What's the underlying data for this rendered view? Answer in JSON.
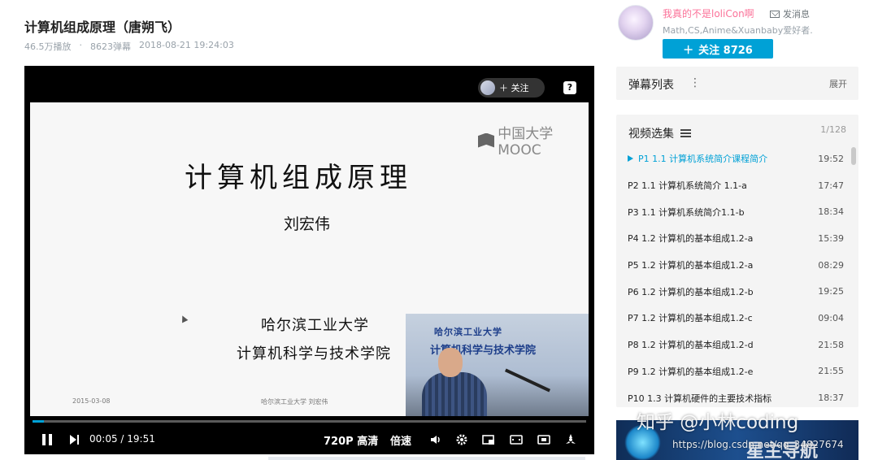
{
  "video": {
    "title": "计算机组成原理（唐朔飞）",
    "views": "46.5万播放",
    "danmaku_count": "8623弹幕",
    "date": "2018-08-21 19:24:03"
  },
  "player": {
    "follow_label": "＋ 关注",
    "help_label": "?",
    "slide": {
      "logo_text": "中国大学MOOC",
      "title": "计算机组成原理",
      "author": "刘宏伟",
      "university": "哈尔滨工业大学",
      "school": "计算机科学与技术学院",
      "date": "2015-03-08",
      "footer": "哈尔滨工业大学  刘宏伟"
    },
    "pip": {
      "line1": "哈尔滨工业大学",
      "line2": "计算机科学与技术学院"
    },
    "controls": {
      "current_time": "00:05",
      "duration": "19:51",
      "time_display": "00:05 / 19:51",
      "progress": 0.004,
      "quality": "720P 高清",
      "speed": "倍速"
    }
  },
  "uploader": {
    "name": "我真的不是loliCon啊",
    "message_label": "发消息",
    "description": "Math,CS,Anime&Xuanbaby爱好者.",
    "follow_button": "关注 8726",
    "follow_icon": "＋"
  },
  "danmaku_panel": {
    "title": "弹幕列表",
    "expand_label": "展开"
  },
  "episodes": {
    "title": "视频选集",
    "count": "1/128",
    "items": [
      {
        "label": "P1   1.1 计算机系统简介课程简介",
        "duration": "19:52",
        "active": true
      },
      {
        "label": "P2   1.1 计算机系统简介 1.1-a",
        "duration": "17:47"
      },
      {
        "label": "P3   1.1 计算机系统简介1.1-b",
        "duration": "18:34"
      },
      {
        "label": "P4   1.2 计算机的基本组成1.2-a",
        "duration": "15:39"
      },
      {
        "label": "P5   1.2 计算机的基本组成1.2-a",
        "duration": "08:29"
      },
      {
        "label": "P6   1.2 计算机的基本组成1.2-b",
        "duration": "19:25"
      },
      {
        "label": "P7   1.2 计算机的基本组成1.2-c",
        "duration": "09:04"
      },
      {
        "label": "P8   1.2 计算机的基本组成1.2-d",
        "duration": "21:58"
      },
      {
        "label": "P9   1.2 计算机的基本组成1.2-e",
        "duration": "21:55"
      },
      {
        "label": "P10  1.3 计算机硬件的主要技术指标",
        "duration": "18:37"
      }
    ]
  },
  "watermarks": {
    "zhihu": "知乎 @小林coding",
    "csdn": "https://blog.csdn.net/qq_34827674"
  },
  "ad": {
    "text": "星主导航"
  },
  "colors": {
    "accent": "#00a1d6",
    "uploader_name": "#fb7299"
  }
}
